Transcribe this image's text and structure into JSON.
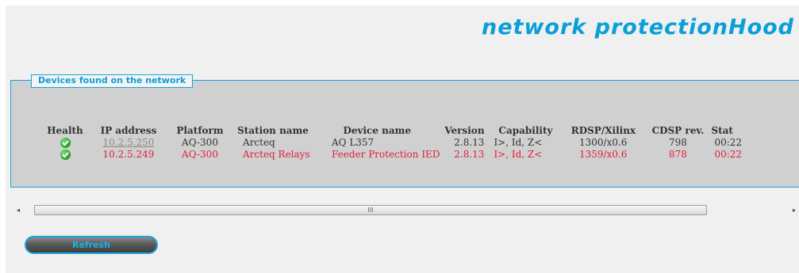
{
  "header": {
    "brand": "network protectionHood"
  },
  "devices_panel": {
    "title": "Devices found on the network",
    "columns": [
      "Health",
      "IP address",
      "Platform",
      "Station name",
      "Device name",
      "Version",
      "Capability",
      "RDSP/Xilinx",
      "CDSP rev.",
      "Stat"
    ],
    "rows": [
      {
        "health": "ok",
        "ip": "10.2.5.250",
        "platform": "AQ-300",
        "station": "Arcteq",
        "device": "AQ L357",
        "version": "2.8.13",
        "capability": "I>, Id, Z<",
        "rdsp": "1300/x0.6",
        "cdsp": "798",
        "status": "00:22",
        "highlight": false
      },
      {
        "health": "ok",
        "ip": "10.2.5.249",
        "platform": "AQ-300",
        "station": "Arcteq Relays",
        "device": "Feeder Protection IED",
        "version": "2.8.13",
        "capability": "I>, Id, Z<",
        "rdsp": "1359/x0.6",
        "cdsp": "878",
        "status": "00:22",
        "highlight": true
      }
    ]
  },
  "scrollbar": {
    "thumb_label": "III",
    "left_arrow": "◂",
    "right_arrow": "▸"
  },
  "actions": {
    "refresh_label": "Refresh"
  },
  "colors": {
    "accent": "#0a9fd8",
    "alert_row": "#e0203a",
    "panel_bg": "#d0d0d0"
  },
  "icons": {
    "health_ok": "check-circle-icon"
  }
}
